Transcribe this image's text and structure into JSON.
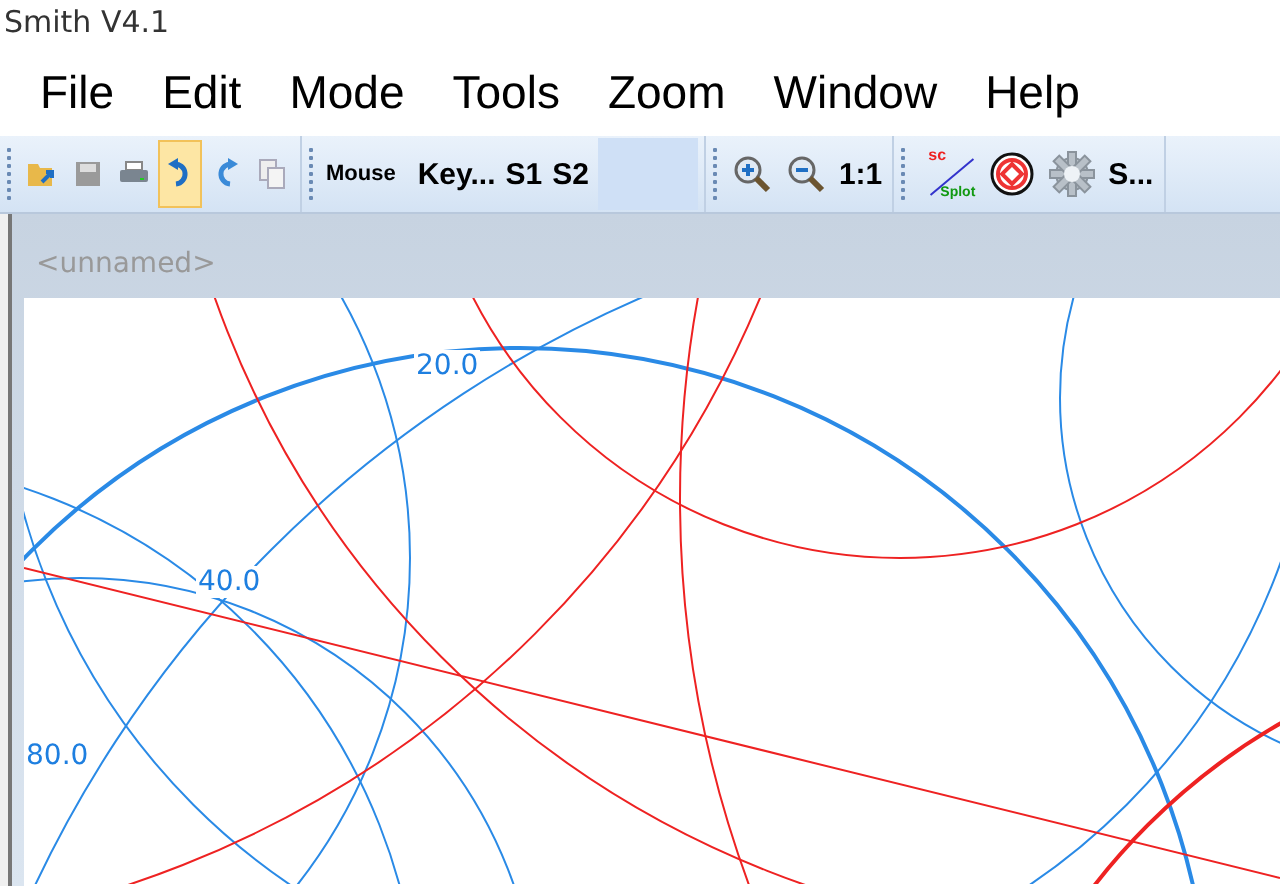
{
  "window": {
    "title": "Smith V4.1"
  },
  "menu": [
    "File",
    "Edit",
    "Mode",
    "Tools",
    "Zoom",
    "Window",
    "Help"
  ],
  "toolbar": {
    "file_buttons": [
      {
        "selected": false
      },
      {
        "selected": false
      },
      {
        "selected": false
      },
      {
        "selected": true
      },
      {
        "selected": false
      },
      {
        "selected": false
      }
    ],
    "input_buttons": [
      "Mouse",
      "Key...",
      "S1",
      "S2"
    ],
    "zoom_label": "1:1",
    "splot_icon": {
      "top": "sc",
      "bottom": "Splot"
    },
    "settings_label": "S..."
  },
  "document": {
    "title": "<unnamed>"
  },
  "chart_labels": [
    "20.0",
    "40.0",
    "80.0"
  ]
}
